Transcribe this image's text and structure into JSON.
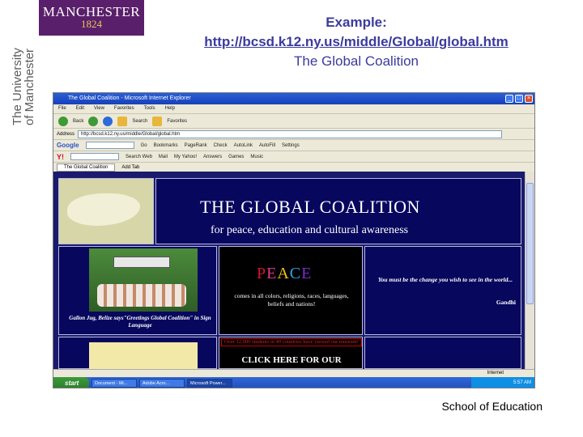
{
  "logo": {
    "name": "MANCHESTER",
    "year": "1824"
  },
  "vertical_text": {
    "line1": "The University",
    "line2": "of Manchester"
  },
  "heading": {
    "line1": "Example:",
    "line2": "http://bcsd.k12.ny.us/middle/Global/global.htm",
    "line3": "The Global Coalition"
  },
  "footer": "School of Education",
  "browser": {
    "window_title": "The Global Coalition - Microsoft Internet Explorer",
    "menu": [
      "File",
      "Edit",
      "View",
      "Favorites",
      "Tools",
      "Help"
    ],
    "toolbar": {
      "back": "Back",
      "search": "Search",
      "favorites": "Favorites"
    },
    "address_label": "Address",
    "address_value": "http://bcsd.k12.ny.us/middle/Global/global.htm",
    "google_bar": {
      "logo": "Google",
      "items": [
        "Go",
        "Bookmarks",
        "PageRank",
        "Check",
        "AutoLink",
        "AutoFill",
        "Settings"
      ]
    },
    "yahoo_bar": {
      "logo": "Y!",
      "items": [
        "Search Web",
        "Mail",
        "My Yahoo!",
        "Answers",
        "Games",
        "Music"
      ]
    },
    "tab_label": "The Global Coalition",
    "add_tab": "Add Tab",
    "status_zone": "Internet"
  },
  "page": {
    "title": "THE GLOBAL COALITION",
    "subtitle": "for peace, education and cultural awareness",
    "photo_caption": "Gallon Jug, Belize says\"Greetings Global Coalition\" in Sign Language",
    "peace": {
      "p": "P",
      "e": "E",
      "a": "A",
      "c": "C",
      "e2": "E"
    },
    "peace_sub": "comes in all colors, religions, races, languages, beliefs and nations!",
    "quote": "You must be the change you wish to see in the world...",
    "quote_author": "Gandhi",
    "students_note": "Over 12,000 students in 40 countries have viewed our museum!",
    "click_text": "CLICK HERE FOR OUR"
  },
  "taskbar": {
    "start": "start",
    "tasks": [
      "Document - Mi...",
      "Adobe Acro...",
      "Microsoft Power..."
    ],
    "clock": "5:57 AM"
  }
}
